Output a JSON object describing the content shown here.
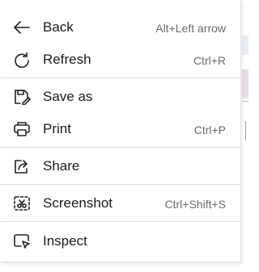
{
  "menu": {
    "items": [
      {
        "label": "Back",
        "shortcut": "Alt+Left arrow",
        "icon": "back-arrow-icon"
      },
      {
        "label": "Refresh",
        "shortcut": "Ctrl+R",
        "icon": "refresh-icon"
      },
      {
        "label": "Save as",
        "shortcut": "",
        "icon": "save-icon"
      },
      {
        "label": "Print",
        "shortcut": "Ctrl+P",
        "icon": "printer-icon"
      },
      {
        "label": "Share",
        "shortcut": "",
        "icon": "share-icon"
      },
      {
        "label": "Screenshot",
        "shortcut": "Ctrl+Shift+S",
        "icon": "screenshot-icon"
      },
      {
        "label": "Inspect",
        "shortcut": "",
        "icon": "inspect-icon"
      }
    ]
  },
  "colors": {
    "text": "#1b1b1b",
    "shortcut": "#6b6b6b",
    "separator": "#dedede"
  }
}
